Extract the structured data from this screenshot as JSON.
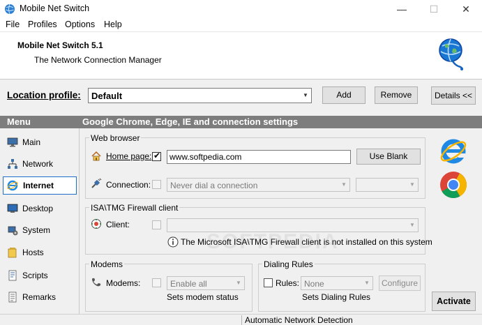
{
  "window": {
    "title": "Mobile Net Switch",
    "controls": {
      "minimize": "—",
      "maximize": "☐",
      "close": "✕"
    }
  },
  "menubar": [
    "File",
    "Profiles",
    "Options",
    "Help"
  ],
  "banner": {
    "app_title": "Mobile Net Switch 5.1",
    "subtitle": "The Network Connection Manager"
  },
  "location": {
    "label": "Location profile:",
    "value": "Default",
    "add_label": "Add",
    "remove_label": "Remove",
    "details_label": "Details <<"
  },
  "header": {
    "menu_label": "Menu",
    "section_title": "Google Chrome, Edge, IE and connection settings"
  },
  "sidebar": {
    "active": "Internet",
    "items": [
      {
        "label": "Main",
        "icon": "monitor-icon"
      },
      {
        "label": "Network",
        "icon": "network-icon"
      },
      {
        "label": "Internet",
        "icon": "ie-icon"
      },
      {
        "label": "Desktop",
        "icon": "desktop-icon"
      },
      {
        "label": "System",
        "icon": "system-icon"
      },
      {
        "label": "Hosts",
        "icon": "hosts-icon"
      },
      {
        "label": "Scripts",
        "icon": "scripts-icon"
      },
      {
        "label": "Remarks",
        "icon": "remarks-icon"
      }
    ]
  },
  "web_browser": {
    "group_label": "Web browser",
    "home_label": "Home page:",
    "home_checked": true,
    "home_value": "www.softpedia.com",
    "use_blank_label": "Use Blank",
    "connection_label": "Connection:",
    "connection_checked": false,
    "connection_value": "Never dial a connection",
    "connection_sub_value": ""
  },
  "isa": {
    "group_label": "ISA\\TMG Firewall client",
    "client_label": "Client:",
    "client_checked": false,
    "client_value": "",
    "info_text": "The Microsoft ISA\\TMG Firewall client is not installed on this system"
  },
  "modems": {
    "group_label": "Modems",
    "modems_label": "Modems:",
    "modems_checked": false,
    "modems_value": "Enable all",
    "status_text": "Sets modem status"
  },
  "dialing": {
    "group_label": "Dialing Rules",
    "rules_label": "Rules:",
    "rules_checked": false,
    "rules_value": "None",
    "configure_label": "Configure",
    "status_text": "Sets Dialing Rules"
  },
  "activate_label": "Activate",
  "statusbar": {
    "text": "Automatic Network Detection"
  },
  "watermark": "SOFTPEDIA",
  "colors": {
    "header_bar": "#7d7d7d",
    "active_border": "#1e6fc9",
    "ie_blue": "#1e88e5",
    "chrome_red": "#db4437",
    "chrome_yellow": "#f4b400",
    "chrome_green": "#0f9d58"
  }
}
